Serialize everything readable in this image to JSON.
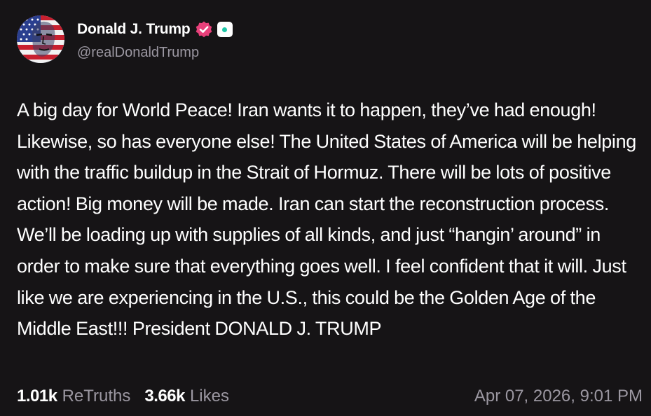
{
  "author": {
    "display_name": "Donald J. Trump",
    "handle": "@realDonaldTrump",
    "avatar_icon": "flag-portrait-avatar",
    "verified_icon": "verified-badge-icon",
    "verified_color": "#e8407a",
    "platform_icon": "truth-social-icon"
  },
  "post": {
    "text": "A big day for World Peace! Iran wants it to happen, they’ve had enough! Likewise, so has everyone else! The United States of America will be helping with the traffic buildup in the Strait of Hormuz. There will be lots of positive action! Big money will be made. Iran can start the reconstruction process. We’ll be loading up with supplies of all kinds, and just “hangin’ around” in order to make sure that everything goes well. I feel confident that it will. Just like we are experiencing in the U.S., this could be the Golden Age of the Middle East!!! President DONALD J. TRUMP",
    "retruths_count": "1.01k",
    "retruths_label": "ReTruths",
    "likes_count": "3.66k",
    "likes_label": "Likes",
    "timestamp": "Apr 07, 2026, 9:01 PM"
  },
  "colors": {
    "background": "#161416",
    "text": "#ffffff",
    "muted": "#9b97a1"
  }
}
